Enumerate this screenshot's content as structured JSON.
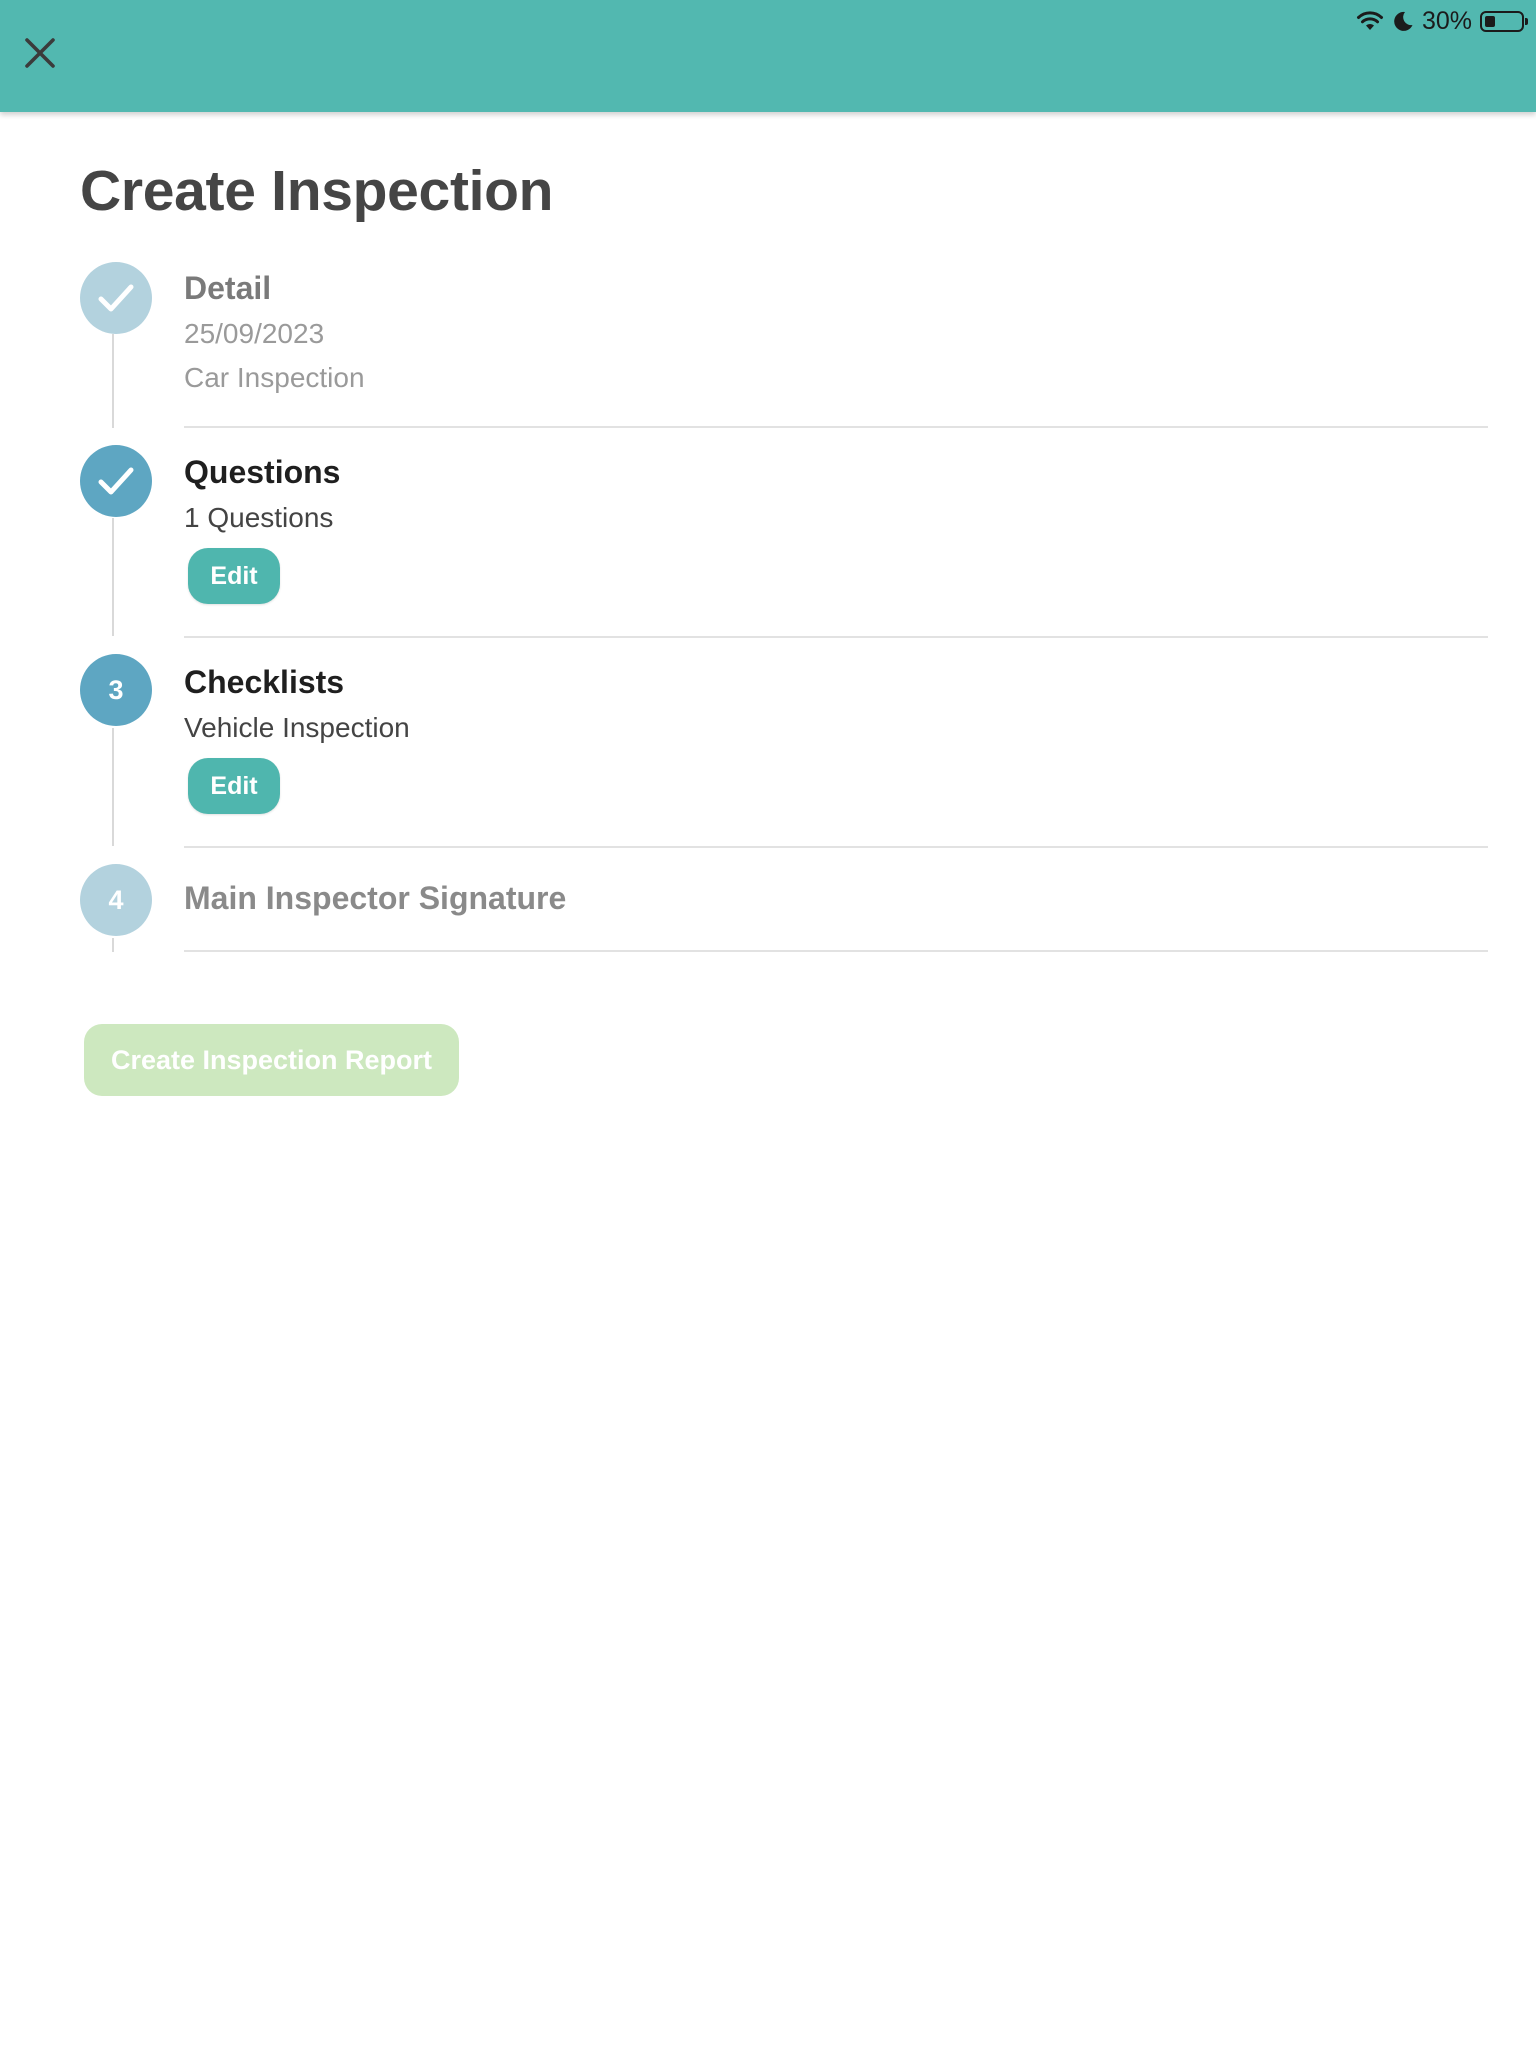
{
  "status_bar": {
    "battery_text": "30%",
    "battery_level": 0.3,
    "wifi_icon": "wifi-icon",
    "dnd_icon": "moon-icon"
  },
  "app_bar": {
    "close_icon": "close-icon",
    "color": "#52b8b0"
  },
  "page": {
    "title": "Create Inspection"
  },
  "steps": [
    {
      "number": "1",
      "state": "completed",
      "icon": "check-icon",
      "title": "Detail",
      "lines": [
        "25/09/2023",
        "Car Inspection"
      ],
      "color": "#b3d2de"
    },
    {
      "number": "2",
      "state": "completed-active",
      "icon": "check-icon",
      "title": "Questions",
      "lines": [
        "1 Questions"
      ],
      "edit_label": "Edit",
      "color": "#5ea6c2"
    },
    {
      "number": "3",
      "state": "current",
      "title": "Checklists",
      "lines": [
        "Vehicle Inspection"
      ],
      "edit_label": "Edit",
      "color": "#5ea6c2"
    },
    {
      "number": "4",
      "state": "pending",
      "title": "Main Inspector Signature",
      "lines": [],
      "color": "#b3d2de"
    }
  ],
  "actions": {
    "create_report_label": "Create Inspection Report",
    "create_report_enabled": false,
    "create_report_color": "#cde8bf",
    "edit_button_color": "#4fb6ae"
  }
}
